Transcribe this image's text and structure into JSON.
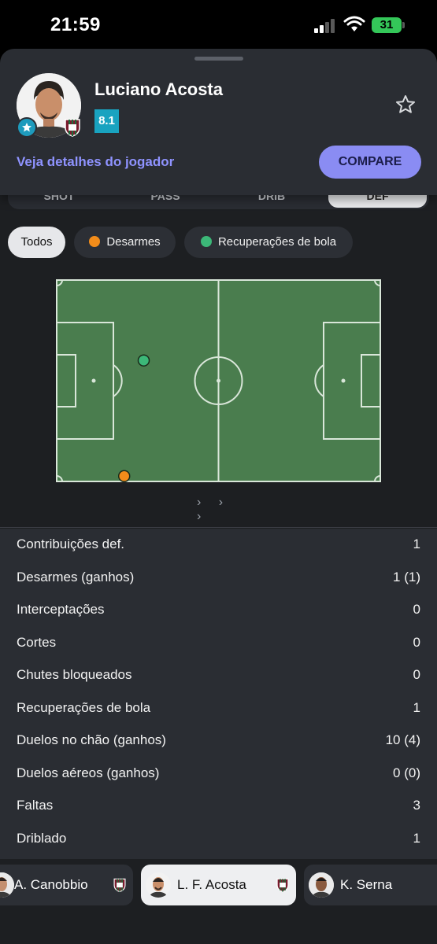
{
  "status_bar": {
    "time": "21:59",
    "battery": "31"
  },
  "player": {
    "name": "Luciano Acosta",
    "rating": "8.1",
    "details_link": "Veja detalhes do jogador",
    "compare_label": "COMPARE"
  },
  "tabs": [
    {
      "label": "SHOT"
    },
    {
      "label": "PASS"
    },
    {
      "label": "DRIB"
    },
    {
      "label": "DEF"
    }
  ],
  "filters": [
    {
      "label": "Todos",
      "color": ""
    },
    {
      "label": "Desarmes",
      "color": "#f28c1a"
    },
    {
      "label": "Recuperações de bola",
      "color": "#3cb878"
    }
  ],
  "pitch": {
    "events": [
      {
        "type": "Recuperações de bola",
        "x": 27,
        "y": 40,
        "color": "#3cb878"
      },
      {
        "type": "Desarmes",
        "x": 21,
        "y": 97,
        "color": "#f28c1a"
      }
    ]
  },
  "pager_label": "› › ›",
  "stats": [
    {
      "label": "Contribuições def.",
      "value": "1"
    },
    {
      "label": "Desarmes (ganhos)",
      "value": "1 (1)"
    },
    {
      "label": "Interceptações",
      "value": "0"
    },
    {
      "label": "Cortes",
      "value": "0"
    },
    {
      "label": "Chutes bloqueados",
      "value": "0"
    },
    {
      "label": "Recuperações de bola",
      "value": "1"
    },
    {
      "label": "Duelos no chão (ganhos)",
      "value": "10 (4)"
    },
    {
      "label": "Duelos aéreos (ganhos)",
      "value": "0 (0)"
    },
    {
      "label": "Faltas",
      "value": "3"
    },
    {
      "label": "Driblado",
      "value": "1"
    }
  ],
  "player_switcher": [
    {
      "name": "A. Canobbio"
    },
    {
      "name": "L. F. Acosta"
    },
    {
      "name": "K. Serna"
    }
  ],
  "colors": {
    "accent": "#8a8cf3",
    "rating": "#19a3c0",
    "pitch": "#4a7d4e"
  }
}
